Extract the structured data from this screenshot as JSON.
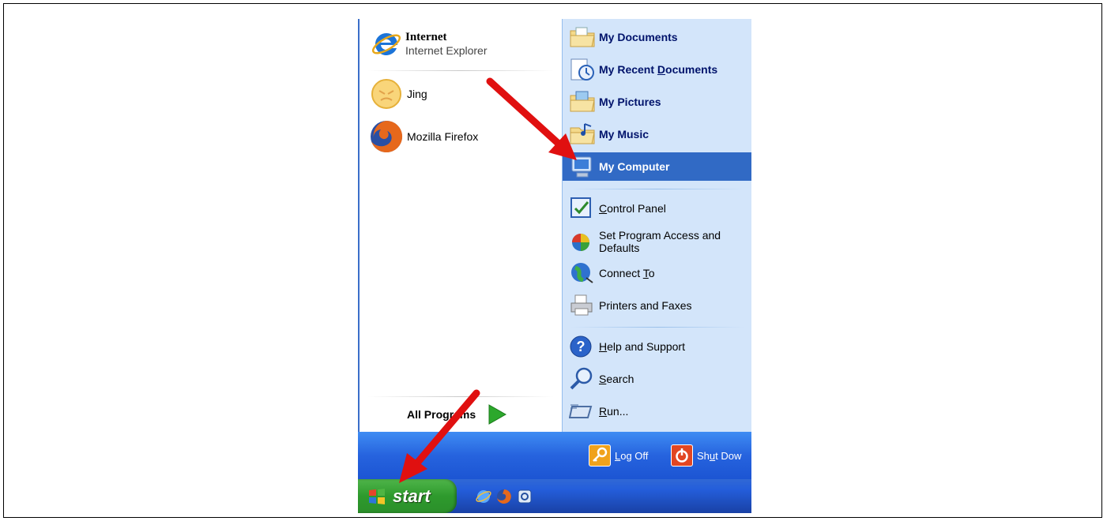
{
  "pinned": [
    {
      "title": "Internet",
      "subtitle": "Internet Explorer"
    }
  ],
  "recent_programs": [
    {
      "label": "Jing"
    },
    {
      "label": "Mozilla Firefox"
    }
  ],
  "all_programs": {
    "label_a": "All Pro",
    "label_u": "g",
    "label_b": "rams"
  },
  "places": [
    {
      "label": "My Documents"
    },
    {
      "label_a": "My Recent ",
      "label_u": "D",
      "label_b": "ocuments"
    },
    {
      "label": "My Pictures"
    },
    {
      "label": "My Music"
    },
    {
      "label": "My Computer"
    }
  ],
  "system": [
    {
      "label_u": "C",
      "label_b": "ontrol Panel"
    },
    {
      "label_l1": "Set Program Access and",
      "label_l2": "Defaults"
    },
    {
      "label_a": "Connect ",
      "label_u": "T",
      "label_b": "o"
    },
    {
      "label": "Printers and Faxes"
    }
  ],
  "help": [
    {
      "label_u": "H",
      "label_b": "elp and Support"
    },
    {
      "label_u": "S",
      "label_b": "earch"
    },
    {
      "label_u": "R",
      "label_b": "un..."
    }
  ],
  "footer": {
    "logoff_u": "L",
    "logoff_b": "og Off",
    "shutdown_a": "Sh",
    "shutdown_u": "u",
    "shutdown_b": "t Dow"
  },
  "taskbar": {
    "start_label": "start"
  },
  "colors": {
    "selected": "#316ac5",
    "annotation_arrow": "#e01010"
  }
}
